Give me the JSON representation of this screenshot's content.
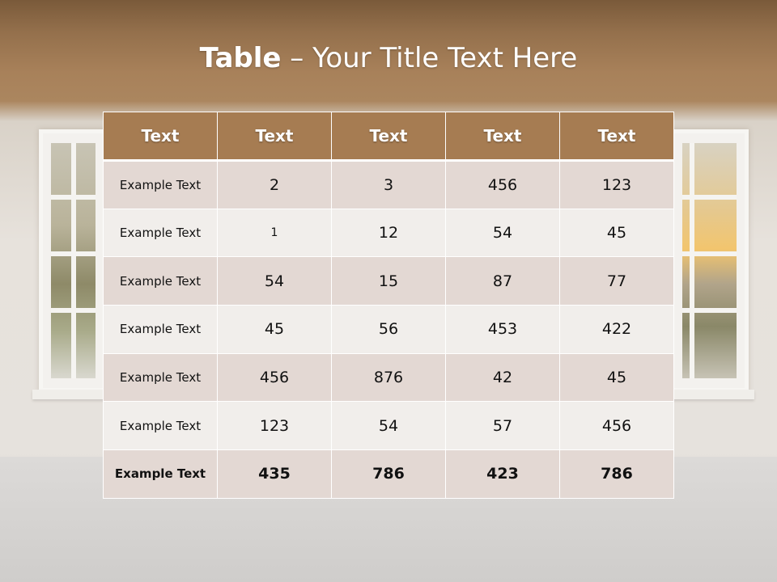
{
  "slide": {
    "title_bold": "Table",
    "title_rest": " – Your Title Text Here"
  },
  "table": {
    "headers": [
      "Text",
      "Text",
      "Text",
      "Text",
      "Text"
    ],
    "rows": [
      [
        "Example Text",
        "2",
        "3",
        "456",
        "123"
      ],
      [
        "Example Text",
        "1",
        "12",
        "54",
        "45"
      ],
      [
        "Example Text",
        "54",
        "15",
        "87",
        "77"
      ],
      [
        "Example Text",
        "45",
        "56",
        "453",
        "422"
      ],
      [
        "Example Text",
        "456",
        "876",
        "42",
        "45"
      ],
      [
        "Example Text",
        "123",
        "54",
        "57",
        "456"
      ],
      [
        "Example Text",
        "435",
        "786",
        "423",
        "786"
      ]
    ]
  },
  "colors": {
    "header_fill": "#a67c52",
    "row_fill_dark": "#e3d8d3",
    "row_fill_light": "#f1eeeb",
    "title_text": "#ffffff"
  }
}
